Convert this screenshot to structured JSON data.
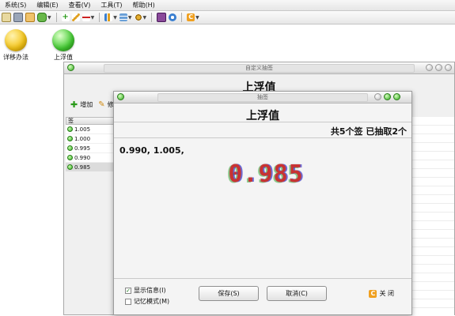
{
  "menubar": {
    "items": [
      "系统(S)",
      "编辑(E)",
      "查看(V)",
      "工具(T)",
      "帮助(H)"
    ]
  },
  "toolbar": {
    "icons": [
      "new-icon",
      "wrench-icon",
      "note-icon",
      "database-icon",
      "add-icon",
      "edit-icon",
      "remove-icon",
      "chart-icon",
      "table-icon",
      "gear-icon",
      "book-icon",
      "refresh-icon",
      "close-app-icon"
    ]
  },
  "desktop": {
    "icons": [
      {
        "label": "详移办法",
        "color": "#f5c518"
      },
      {
        "label": "上浮值",
        "color": "#44cc33"
      }
    ]
  },
  "back_window": {
    "title": "自定义抽签",
    "heading": "上浮值",
    "add_label": "增加",
    "edit_label": "修",
    "list_header": "签",
    "items": [
      "1.005",
      "1.000",
      "0.995",
      "0.990",
      "0.985"
    ]
  },
  "dialog": {
    "title": "抽签",
    "heading": "上浮值",
    "count_text": "共5个签 已抽取2个",
    "drawn": "0.990, 1.005,",
    "current": "0.985",
    "show_info_label": "显示信息(I)",
    "memory_mode_label": "记忆模式(M)",
    "save_label": "保存(S)",
    "cancel_label": "取消(C)",
    "close_label": "关 闭",
    "show_info_checked": true,
    "memory_mode_checked": false
  }
}
